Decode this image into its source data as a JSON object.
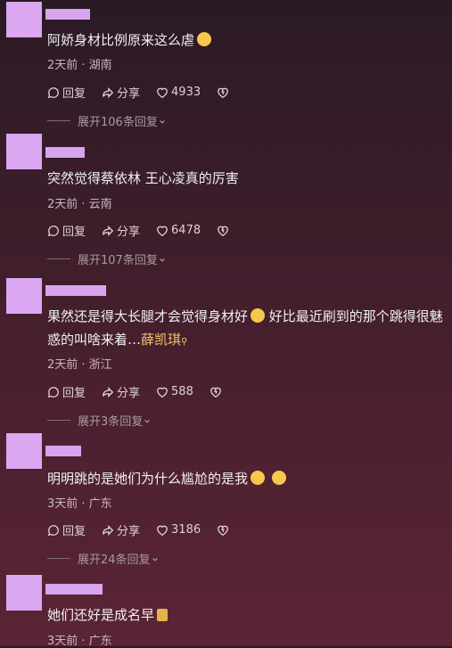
{
  "comments": [
    {
      "text": "阿娇身材比例原来这么虐",
      "meta": "2天前 · 湖南",
      "reply": "回复",
      "share": "分享",
      "likes": "4933",
      "expand": "展开106条回复"
    },
    {
      "text": "突然觉得蔡依林 王心凌真的厉害",
      "meta": "2天前 · 云南",
      "reply": "回复",
      "share": "分享",
      "likes": "6478",
      "expand": "展开107条回复"
    },
    {
      "text": "果然还是得大长腿才会觉得身材好",
      "text2": " 好比最近刷到的那个跳得很魅惑的叫啥来着…",
      "mention": "薛凯琪",
      "meta": "2天前 · 浙江",
      "reply": "回复",
      "share": "分享",
      "likes": "588",
      "expand": "展开3条回复"
    },
    {
      "text": "明明跳的是她们为什么尴尬的是我",
      "meta": "3天前 · 广东",
      "reply": "回复",
      "share": "分享",
      "likes": "3186",
      "expand": "展开24条回复"
    },
    {
      "text": "她们还好是成名早",
      "meta": "3天前 · 广东"
    }
  ],
  "icons": {
    "reply": "comment-icon",
    "share": "share-icon",
    "like": "heart-icon",
    "dislike": "dislike-heart-icon",
    "chevron": "chevron-down-icon"
  }
}
